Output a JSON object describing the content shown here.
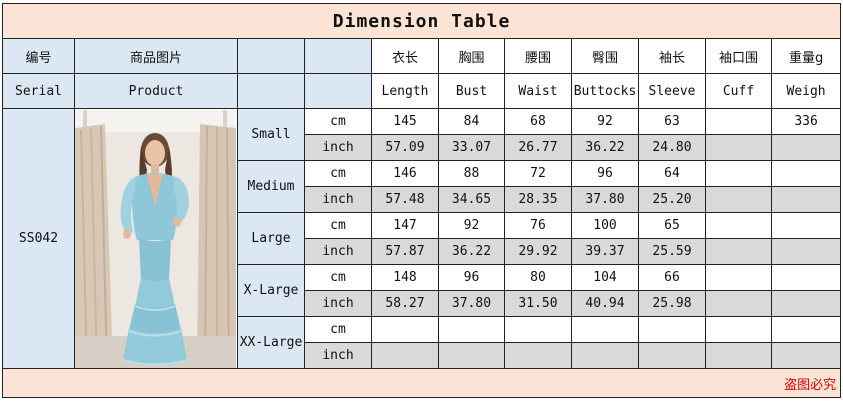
{
  "title": "Dimension Table",
  "header_zh": {
    "serial": "编号",
    "product": "商品图片",
    "length": "衣长",
    "bust": "胸围",
    "waist": "腰围",
    "buttocks": "臀围",
    "sleeve": "袖长",
    "cuff": "袖口围",
    "weight": "重量g"
  },
  "header_en": {
    "serial": "Serial",
    "product": "Product",
    "length": "Length",
    "bust": "Bust",
    "waist": "Waist",
    "buttocks": "Buttocks",
    "sleeve": "Sleeve",
    "cuff": "Cuff",
    "weight": "Weigh"
  },
  "serial_value": "SS042",
  "units": {
    "cm": "cm",
    "inch": "inch"
  },
  "sizes": [
    {
      "name": "Small",
      "cm": {
        "length": "145",
        "bust": "84",
        "waist": "68",
        "buttocks": "92",
        "sleeve": "63",
        "cuff": "",
        "weight": "336"
      },
      "inch": {
        "length": "57.09",
        "bust": "33.07",
        "waist": "26.77",
        "buttocks": "36.22",
        "sleeve": "24.80",
        "cuff": "",
        "weight": ""
      }
    },
    {
      "name": "Medium",
      "cm": {
        "length": "146",
        "bust": "88",
        "waist": "72",
        "buttocks": "96",
        "sleeve": "64",
        "cuff": "",
        "weight": ""
      },
      "inch": {
        "length": "57.48",
        "bust": "34.65",
        "waist": "28.35",
        "buttocks": "37.80",
        "sleeve": "25.20",
        "cuff": "",
        "weight": ""
      }
    },
    {
      "name": "Large",
      "cm": {
        "length": "147",
        "bust": "92",
        "waist": "76",
        "buttocks": "100",
        "sleeve": "65",
        "cuff": "",
        "weight": ""
      },
      "inch": {
        "length": "57.87",
        "bust": "36.22",
        "waist": "29.92",
        "buttocks": "39.37",
        "sleeve": "25.59",
        "cuff": "",
        "weight": ""
      }
    },
    {
      "name": "X-Large",
      "cm": {
        "length": "148",
        "bust": "96",
        "waist": "80",
        "buttocks": "104",
        "sleeve": "66",
        "cuff": "",
        "weight": ""
      },
      "inch": {
        "length": "58.27",
        "bust": "37.80",
        "waist": "31.50",
        "buttocks": "40.94",
        "sleeve": "25.98",
        "cuff": "",
        "weight": ""
      }
    },
    {
      "name": "XX-Large",
      "cm": {
        "length": "",
        "bust": "",
        "waist": "",
        "buttocks": "",
        "sleeve": "",
        "cuff": "",
        "weight": ""
      },
      "inch": {
        "length": "",
        "bust": "",
        "waist": "",
        "buttocks": "",
        "sleeve": "",
        "cuff": "",
        "weight": ""
      }
    }
  ],
  "footer": "盗图必究",
  "colors": {
    "title_bg": "#fbe4d5",
    "header_bg": "#dbe7f3",
    "inch_row_bg": "#d9d9d9",
    "footer_text": "#e00000",
    "dress": "#8ec8d8"
  },
  "product_image": "model-in-light-blue-tiered-maxi-dress"
}
